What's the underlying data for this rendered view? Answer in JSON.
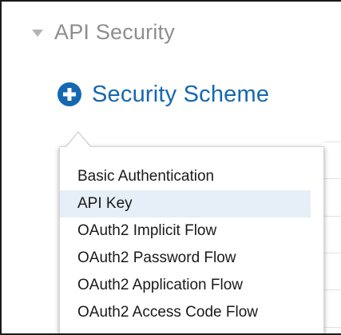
{
  "section": {
    "title": "API Security",
    "expanded_icon": "caret-down-icon"
  },
  "add_scheme": {
    "icon": "plus-circle-icon",
    "label": "Security Scheme",
    "accent_color": "#1568b0"
  },
  "menu": {
    "items": [
      {
        "label": "Basic Authentication",
        "highlighted": false
      },
      {
        "label": "API Key",
        "highlighted": true
      },
      {
        "label": "OAuth2 Implicit Flow",
        "highlighted": false
      },
      {
        "label": "OAuth2 Password Flow",
        "highlighted": false
      },
      {
        "label": "OAuth2 Application Flow",
        "highlighted": false
      },
      {
        "label": "OAuth2 Access Code Flow",
        "highlighted": false
      }
    ],
    "highlight_color": "#e6eef7"
  }
}
